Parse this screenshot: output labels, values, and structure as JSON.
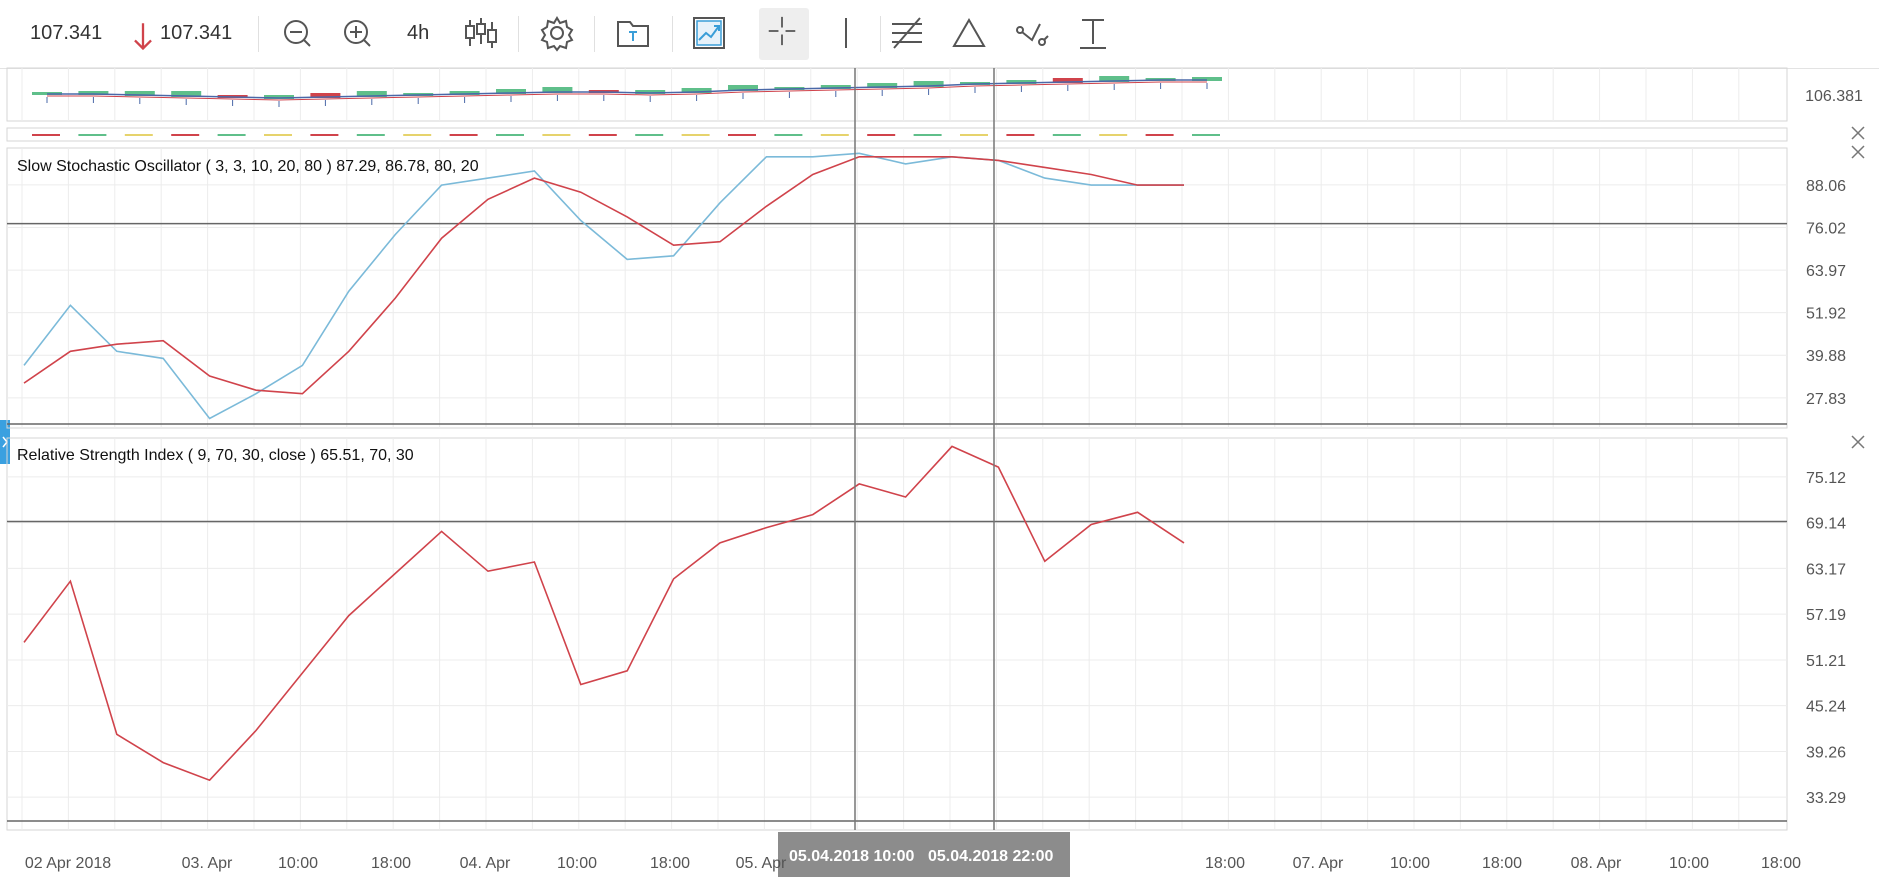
{
  "toolbar": {
    "last_price": "107.341",
    "price_arrow": "down-arrow",
    "price_arrow_color": "#d0434b",
    "close_price": "107.341",
    "interval": "4h",
    "icons": [
      "zoom-out-icon",
      "zoom-in-icon",
      "candlestick-type-icon",
      "settings-icon",
      "template-folder-icon",
      "indicators-icon",
      "crosshair-icon",
      "vertical-line-icon",
      "fibonacci-icon",
      "triangle-icon",
      "trend-line-icon",
      "text-tool-icon"
    ]
  },
  "colors": {
    "stoch_k": "#7bbad9",
    "stoch_d": "#d0434b",
    "rsi": "#d0434b",
    "candle_up": "#5fbf8a",
    "candle_down": "#d0434b",
    "ma_line": "#4a68a8",
    "crosshair_label_bg": "#8c8c8c"
  },
  "chart_data": [
    {
      "type": "line",
      "panel": "price",
      "ytick_labels": [
        "106.381"
      ]
    },
    {
      "type": "line",
      "panel": "stochastic",
      "title": "Slow Stochastic Oscillator ( 3, 3, 10, 20, 80 ) 87.29, 86.78, 80, 20",
      "ytick_labels": [
        "88.06",
        "76.02",
        "63.97",
        "51.92",
        "39.88",
        "27.83"
      ],
      "ylim": [
        19.3,
        98.5
      ],
      "reference_line": 77.1,
      "series": [
        {
          "values": [
            37,
            54,
            41,
            39,
            22,
            29,
            37,
            58,
            74,
            88,
            90,
            92,
            78,
            67,
            68,
            83,
            96,
            96,
            97,
            94,
            96,
            95,
            90,
            88,
            88,
            88
          ]
        },
        {
          "values": [
            32,
            41,
            43,
            44,
            34,
            30,
            29,
            41,
            56,
            73,
            84,
            90,
            86,
            79,
            71,
            72,
            82,
            91,
            96,
            96,
            96,
            95,
            93,
            91,
            88,
            88
          ]
        }
      ]
    },
    {
      "type": "line",
      "panel": "rsi",
      "title": "Relative Strength Index ( 9, 70, 30, close ) 65.51, 70, 30",
      "ytick_labels": [
        "75.12",
        "69.14",
        "63.17",
        "57.19",
        "51.21",
        "45.24",
        "39.26",
        "33.29"
      ],
      "ylim": [
        29,
        80.2
      ],
      "reference_line": 69.3,
      "series": [
        {
          "values": [
            53.5,
            61.5,
            41.5,
            37.8,
            35.5,
            42,
            49.5,
            57,
            62.5,
            68,
            62.8,
            64,
            48,
            49.8,
            61.8,
            66.5,
            68.5,
            70.2,
            74.2,
            72.5,
            79.1,
            76.4,
            64.1,
            68.9,
            70.5,
            66.5
          ]
        }
      ]
    }
  ],
  "x_axis": {
    "tick_labels": [
      "02 Apr 2018",
      "03. Apr",
      "10:00",
      "18:00",
      "04. Apr",
      "10:00",
      "18:00",
      "05. Apr",
      "10:00",
      "18:00",
      "07. Apr",
      "10:00",
      "18:00",
      "08. Apr",
      "10:00",
      "18:00"
    ],
    "crosshair_labels": [
      "05.04.2018 10:00",
      "05.04.2018 22:00"
    ]
  }
}
